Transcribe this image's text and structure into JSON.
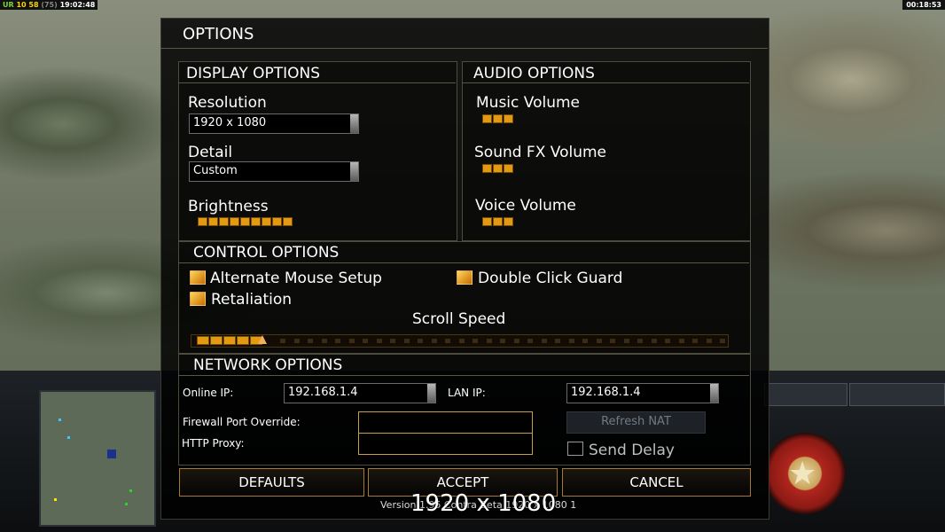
{
  "hud": {
    "left_prefix": "UR",
    "left_a": "10",
    "left_b": "58",
    "left_c": "(75)",
    "left_time": "19:02:48",
    "right_time": "00:18:53"
  },
  "dialog": {
    "title": "OPTIONS",
    "version_text": "Version 1.95 Contra Beta 1920 x 1080 1",
    "overlay_resolution": "1920 x 1080"
  },
  "display": {
    "header": "DISPLAY OPTIONS",
    "resolution_label": "Resolution",
    "resolution_value": "1920 x 1080",
    "detail_label": "Detail",
    "detail_value": "Custom",
    "brightness_label": "Brightness",
    "brightness_level": 9
  },
  "audio": {
    "header": "AUDIO OPTIONS",
    "music_label": "Music Volume",
    "music_level": 3,
    "sfx_label": "Sound FX Volume",
    "sfx_level": 3,
    "voice_label": "Voice Volume",
    "voice_level": 3
  },
  "control": {
    "header": "CONTROL OPTIONS",
    "alt_mouse_label": "Alternate Mouse Setup",
    "alt_mouse_checked": true,
    "double_click_label": "Double Click Guard",
    "double_click_checked": true,
    "retaliation_label": "Retaliation",
    "retaliation_checked": true,
    "scroll_label": "Scroll Speed",
    "scroll_level": 5
  },
  "network": {
    "header": "NETWORK OPTIONS",
    "online_ip_label": "Online IP:",
    "online_ip_value": "192.168.1.4",
    "lan_ip_label": "LAN IP:",
    "lan_ip_value": "192.168.1.4",
    "firewall_label": "Firewall Port Override:",
    "firewall_value": "",
    "proxy_label": "HTTP Proxy:",
    "proxy_value": "",
    "refresh_nat_label": "Refresh NAT",
    "send_delay_label": "Send Delay",
    "send_delay_checked": false
  },
  "buttons": {
    "defaults": "DEFAULTS",
    "accept": "ACCEPT",
    "cancel": "CANCEL"
  },
  "colors": {
    "accent_orange": "#e39a12",
    "border_gold": "#a57a32"
  }
}
